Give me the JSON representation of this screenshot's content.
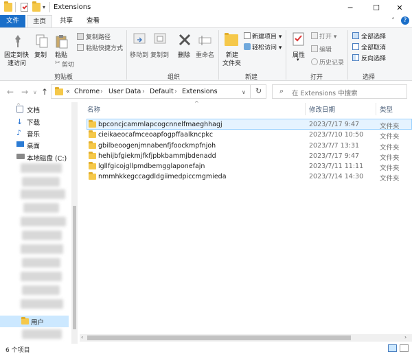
{
  "window": {
    "title": "Extensions",
    "minimize": "─",
    "maximize": "☐",
    "close": "✕"
  },
  "tabs": {
    "file": "文件",
    "home": "主页",
    "share": "共享",
    "view": "查看"
  },
  "ribbon": {
    "pin": "固定到快",
    "pin2": "速访问",
    "copy": "复制",
    "paste": "粘贴",
    "copy_path": "复制路径",
    "paste_shortcut": "粘贴快捷方式",
    "cut": "剪切",
    "clipboard_group": "剪贴板",
    "move_to": "移动到",
    "copy_to": "复制到",
    "delete": "删除",
    "rename": "重命名",
    "organize_group": "组织",
    "new_folder": "新建",
    "new_folder2": "文件夹",
    "new_item": "新建项目 ▾",
    "easy_access": "轻松访问 ▾",
    "new_group": "新建",
    "properties": "属性",
    "open": "打开 ▾",
    "edit": "编辑",
    "history": "历史记录",
    "open_group": "打开",
    "select_all": "全部选择",
    "select_none": "全部取消",
    "invert_select": "反向选择",
    "select_group": "选择"
  },
  "address": {
    "prefix": "«",
    "crumbs": [
      "Chrome",
      "User Data",
      "Default",
      "Extensions"
    ],
    "search_placeholder": "在 Extensions 中搜索"
  },
  "nav": {
    "items": [
      "文档",
      "下载",
      "音乐",
      "桌面",
      "本地磁盘 (C:)",
      "用户"
    ]
  },
  "columns": {
    "name": "名称",
    "date": "修改日期",
    "type": "类型"
  },
  "rows": [
    {
      "name": "bpconcjcammlapcogcnnelfmaeghhagj",
      "date": "2023/7/17 9:47",
      "type": "文件夹"
    },
    {
      "name": "cieikaeocafmceoapfogpffaalkncpkc",
      "date": "2023/7/10 10:50",
      "type": "文件夹"
    },
    {
      "name": "gbilbeoogenjmnabenfjfoockmpfnjoh",
      "date": "2023/7/7 13:31",
      "type": "文件夹"
    },
    {
      "name": "hehijbfgiekmjfkfjpbkbammjbdenadd",
      "date": "2023/7/17 9:47",
      "type": "文件夹"
    },
    {
      "name": "lgllfgicojgllpmdbemgglaponefajn",
      "date": "2023/7/11 11:11",
      "type": "文件夹"
    },
    {
      "name": "nmmhkkegccagdldgiimedpiccmgmieda",
      "date": "2023/7/14 14:30",
      "type": "文件夹"
    }
  ],
  "status": {
    "count": "6 个项目"
  }
}
